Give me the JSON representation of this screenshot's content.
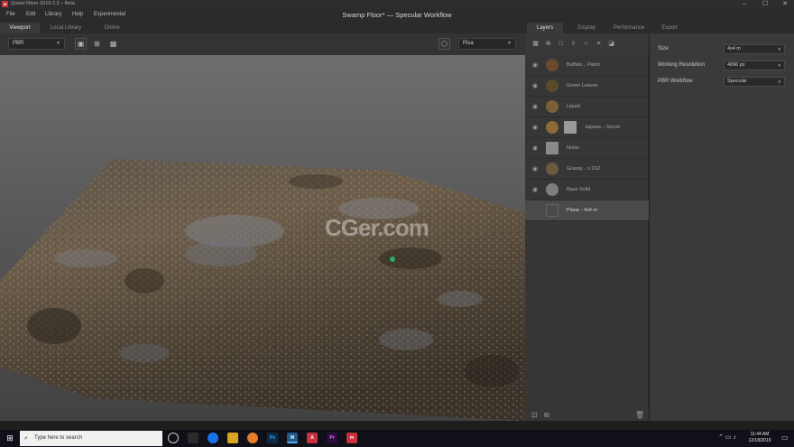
{
  "window": {
    "app_title": "Quixel Mixer 2019.2.3 – Beta",
    "logo_text": "M",
    "controls": {
      "minimize": "–",
      "maximize": "☐",
      "close": "✕"
    }
  },
  "menu": {
    "file": "File",
    "edit": "Edit",
    "library": "Library",
    "help": "Help",
    "experimental": "Experimental"
  },
  "document_title": "Swamp Floor* — Specular Workflow",
  "left_tabs": {
    "viewport": "Viewport",
    "local_library": "Local Library",
    "online": "Online"
  },
  "viewport_toolbar": {
    "mode_value": "PBR",
    "environment_value": "Pisa"
  },
  "viewport": {
    "watermark": "CGer.com"
  },
  "right_tabs": {
    "layers": "Layers",
    "display": "Display",
    "performance": "Performance",
    "export": "Export"
  },
  "layers": [
    {
      "name": "Buffalo... Patch",
      "thumb": "#6b4a2e"
    },
    {
      "name": "Green Leaves",
      "thumb": "#5a4a2a"
    },
    {
      "name": "Liquid",
      "thumb": "#7a6038"
    },
    {
      "name": "Japane... Groun",
      "thumb": "#8a6a35"
    },
    {
      "name": "Noise",
      "thumb": "#8a8a8a"
    },
    {
      "name": "Grassy... s 2X2",
      "thumb": "#6a5a3e"
    },
    {
      "name": "Base Solid",
      "thumb": "#7d7d7d"
    },
    {
      "name": "Plane - 4x4 m",
      "thumb": "#4a4a4a"
    }
  ],
  "properties": {
    "size_label": "Size",
    "size_value": "4x4 m",
    "resolution_label": "Working Resolution",
    "resolution_value": "4096 px",
    "workflow_label": "PBR Workflow",
    "workflow_value": "Specular"
  },
  "taskbar": {
    "search_placeholder": "Type here to search",
    "time": "11:44 AM",
    "date": "12/18/2019",
    "apps": [
      {
        "label": "",
        "color": "#2a2a2a"
      },
      {
        "label": "",
        "color": "#1a73e8"
      },
      {
        "label": "",
        "color": "#d9a520"
      },
      {
        "label": "",
        "color": "#e87d2b"
      },
      {
        "label": "Ps",
        "color": "#0e2a47"
      },
      {
        "label": "M",
        "color": "#1f5a8a"
      },
      {
        "label": "",
        "color": "#5d5d5d"
      },
      {
        "label": "A",
        "color": "#c8323c"
      },
      {
        "label": "Pr",
        "color": "#2b0b40"
      },
      {
        "label": "m",
        "color": "#c8323c"
      }
    ]
  }
}
